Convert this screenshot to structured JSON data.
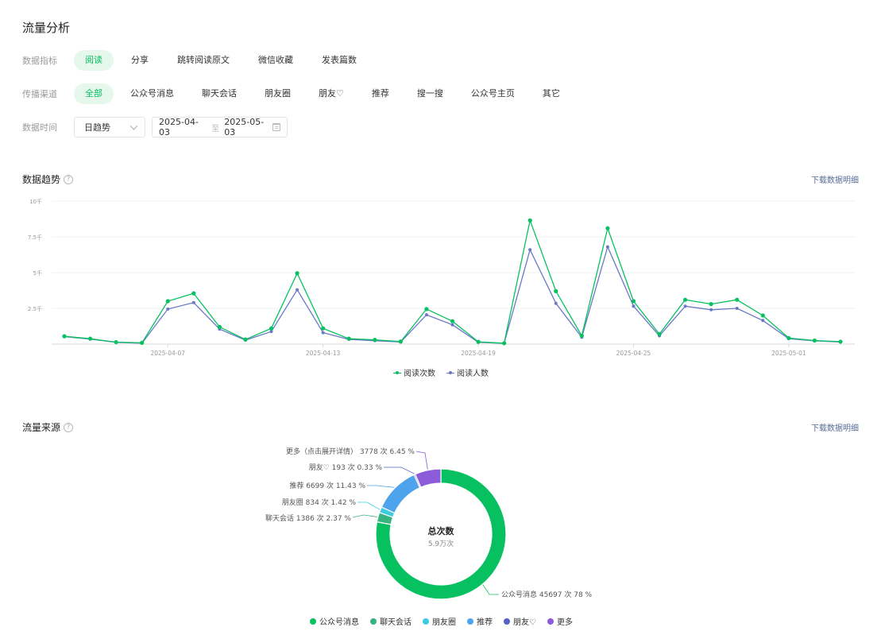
{
  "page_title": "流量分析",
  "filters": {
    "metric": {
      "label": "数据指标",
      "options": [
        "阅读",
        "分享",
        "跳转阅读原文",
        "微信收藏",
        "发表篇数"
      ],
      "active_index": 0
    },
    "channel": {
      "label": "传播渠道",
      "options": [
        "全部",
        "公众号消息",
        "聊天会话",
        "朋友圈",
        "朋友♡",
        "推荐",
        "搜一搜",
        "公众号主页",
        "其它"
      ],
      "active_index": 0
    },
    "time": {
      "label": "数据时间",
      "granularity": "日趋势",
      "start_date": "2025-04-03",
      "separator": "至",
      "end_date": "2025-05-03"
    }
  },
  "trend": {
    "title": "数据趋势",
    "help": "?",
    "download": "下载数据明细",
    "legend": [
      "阅读次数",
      "阅读人数"
    ]
  },
  "source": {
    "title": "流量来源",
    "help": "?",
    "download": "下载数据明细",
    "center_title": "总次数",
    "center_value": "5.9万次",
    "labels": {
      "more": "更多（点击展开详情） 3778 次 6.45 %",
      "friend": "朋友♡ 193 次 0.33 %",
      "recommend": "推荐 6699 次 11.43 %",
      "moments": "朋友圈 834 次 1.42 %",
      "chat": "聊天会话 1386 次 2.37 %",
      "official": "公众号消息 45697 次 78 %"
    },
    "legend": [
      "公众号消息",
      "聊天会话",
      "朋友圈",
      "推荐",
      "朋友♡",
      "更多"
    ]
  },
  "colors": {
    "accent": "#07c160",
    "reads": "#07c160",
    "readers": "#6a78c8",
    "link": "#576b95",
    "official": "#07c160",
    "chat": "#36b37e",
    "moments": "#3dcbe0",
    "recommend": "#4ea4ec",
    "friend": "#5461c8",
    "more": "#8c5bd9"
  },
  "chart_data": [
    {
      "type": "line",
      "x": [
        "2025-04-03",
        "2025-04-04",
        "2025-04-05",
        "2025-04-06",
        "2025-04-07",
        "2025-04-08",
        "2025-04-09",
        "2025-04-10",
        "2025-04-11",
        "2025-04-12",
        "2025-04-13",
        "2025-04-14",
        "2025-04-15",
        "2025-04-16",
        "2025-04-17",
        "2025-04-18",
        "2025-04-19",
        "2025-04-20",
        "2025-04-21",
        "2025-04-22",
        "2025-04-23",
        "2025-04-24",
        "2025-04-25",
        "2025-04-26",
        "2025-04-27",
        "2025-04-28",
        "2025-04-29",
        "2025-04-30",
        "2025-05-01",
        "2025-05-02",
        "2025-05-03"
      ],
      "x_tick_labels": [
        "2025-04-07",
        "2025-04-13",
        "2025-04-19",
        "2025-04-25",
        "2025-05-01"
      ],
      "y_tick_labels": [
        "2.5千",
        "5千",
        "7.5千",
        "10千"
      ],
      "ylim": [
        0,
        10000
      ],
      "grid": true,
      "legend_position": "bottom",
      "series": [
        {
          "name": "阅读次数",
          "values": [
            550,
            380,
            140,
            90,
            3000,
            3550,
            1200,
            320,
            1100,
            4950,
            1100,
            380,
            300,
            180,
            2450,
            1600,
            160,
            60,
            8650,
            3700,
            580,
            8100,
            3000,
            700,
            3100,
            2800,
            3100,
            2000,
            420,
            250,
            170
          ]
        },
        {
          "name": "阅读人数",
          "values": [
            520,
            350,
            120,
            60,
            2450,
            2900,
            1050,
            280,
            880,
            3800,
            800,
            330,
            240,
            150,
            2050,
            1350,
            130,
            50,
            6600,
            2850,
            480,
            6800,
            2650,
            580,
            2650,
            2400,
            2500,
            1650,
            380,
            230,
            150
          ]
        }
      ]
    },
    {
      "type": "pie",
      "categories": [
        "公众号消息",
        "聊天会话",
        "朋友圈",
        "推荐",
        "朋友♡",
        "更多"
      ],
      "values": [
        45697,
        1386,
        834,
        6699,
        193,
        3778
      ],
      "percents": [
        78,
        2.37,
        1.42,
        11.43,
        0.33,
        6.45
      ],
      "total_label": "5.9万次",
      "legend_position": "bottom"
    }
  ]
}
